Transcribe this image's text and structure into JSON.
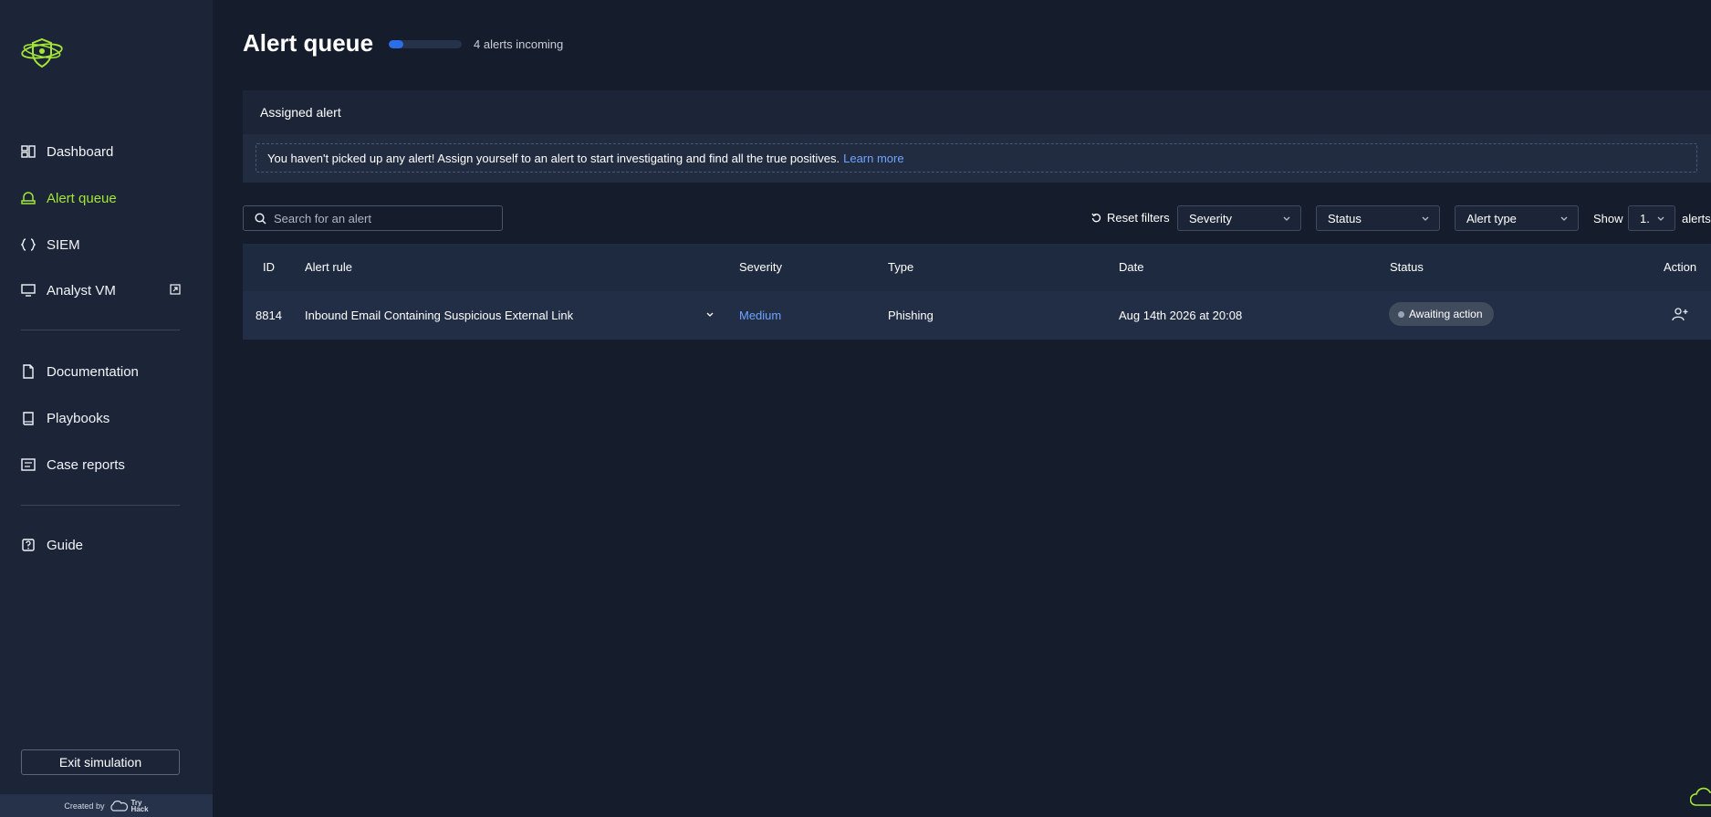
{
  "sidebar": {
    "items": [
      {
        "label": "Dashboard",
        "icon": "dashboard-icon"
      },
      {
        "label": "Alert queue",
        "icon": "alert-queue-icon",
        "active": true
      },
      {
        "label": "SIEM",
        "icon": "siem-braces-icon"
      },
      {
        "label": "Analyst VM",
        "icon": "monitor-icon"
      },
      {
        "label": "Documentation",
        "icon": "document-icon"
      },
      {
        "label": "Playbooks",
        "icon": "book-icon"
      },
      {
        "label": "Case reports",
        "icon": "case-report-icon"
      },
      {
        "label": "Guide",
        "icon": "question-icon"
      }
    ],
    "exit_label": "Exit simulation",
    "created_by": "Created by",
    "brand_line1": "Try",
    "brand_line2": "Hack"
  },
  "header": {
    "title": "Alert queue",
    "incoming_text": "4 alerts incoming",
    "progress_fraction": 0.2
  },
  "assigned": {
    "title": "Assigned alert",
    "notice": "You haven't picked up any alert! Assign yourself to an alert to start investigating and find all the true positives.",
    "learn_more": "Learn more"
  },
  "filters": {
    "search_placeholder": "Search for an alert",
    "reset_label": "Reset filters",
    "severity_label": "Severity",
    "status_label": "Status",
    "alert_type_label": "Alert type",
    "show_label": "Show",
    "show_value": "1.",
    "alerts_label": "alerts"
  },
  "table": {
    "columns": [
      "ID",
      "Alert rule",
      "Severity",
      "Type",
      "Date",
      "Status",
      "Action"
    ],
    "rows": [
      {
        "id": "8814",
        "rule": "Inbound Email Containing Suspicious External Link",
        "severity": "Medium",
        "type": "Phishing",
        "date": "Aug 14th 2026 at 20:08",
        "status": "Awaiting action"
      }
    ]
  },
  "colors": {
    "accent": "#a3e635",
    "link": "#6ea3ff",
    "background": "#151c2c",
    "sidebar": "#1c2538"
  }
}
